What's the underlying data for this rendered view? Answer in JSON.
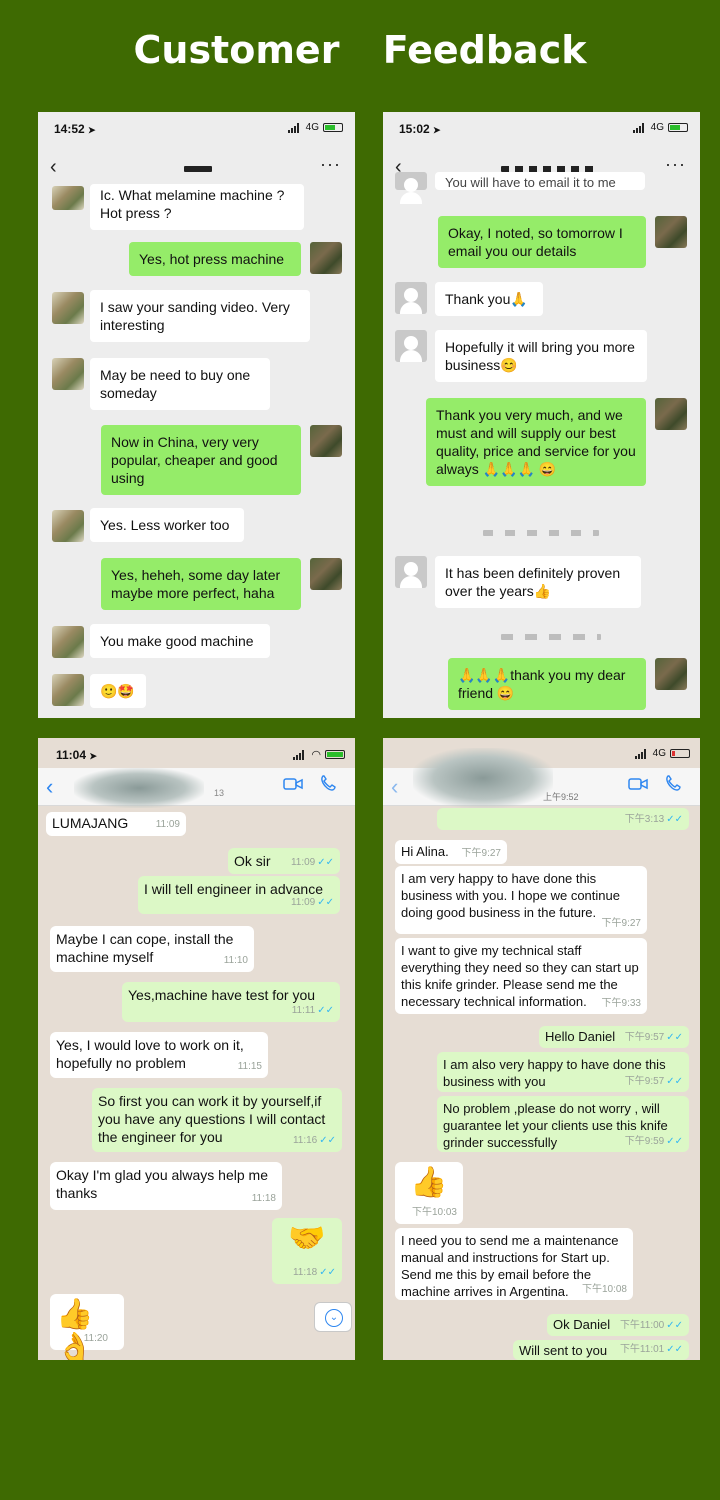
{
  "page_title_left": "Customer",
  "page_title_right": "Feedback",
  "panel1": {
    "time": "14:52",
    "network": "4G",
    "messages": {
      "m1": "Ic. What melamine machine ? Hot press ?",
      "m2": "Yes, hot press machine",
      "m3": "I saw your sanding video. Very interesting",
      "m4": "May be need to buy one someday",
      "m5": "Now in China, very very popular, cheaper and good using",
      "m6": "Yes. Less worker too",
      "m7": "Yes, heheh, some day later maybe more perfect, haha",
      "m8": "You make good machine",
      "m9": "🙂🤩"
    }
  },
  "panel2": {
    "time": "15:02",
    "network": "4G",
    "messages": {
      "m0": "You will have to email it to me",
      "m1": "Okay, I noted, so tomorrow I email you our details",
      "m2": "Thank you🙏",
      "m3": "Hopefully it will bring you more  business😊",
      "m4": "Thank you very much, and we must and will supply our best quality, price and service for you always 🙏🙏🙏 😄",
      "m5": "It has been definitely proven over the years👍",
      "m6": "🙏🙏🙏thank you my dear friend 😄"
    }
  },
  "panel3": {
    "time": "11:04",
    "header_fragment": "13",
    "messages": [
      {
        "text": "LUMAJANG",
        "time": "11:09"
      },
      {
        "text": "Ok sir",
        "time": "11:09"
      },
      {
        "text": "I will tell engineer in advance",
        "time": "11:09"
      },
      {
        "text": "Maybe I can cope, install the machine myself",
        "time": "11:10"
      },
      {
        "text": "Yes,machine have test for you",
        "time": "11:11"
      },
      {
        "text": "Yes, I would love to work on it, hopefully no problem",
        "time": "11:15"
      },
      {
        "text": "So first you can  work it by yourself,if you have any questions I will contact the engineer for you",
        "time": "11:16"
      },
      {
        "text": "Okay I'm glad you always help me thanks",
        "time": "11:18"
      },
      {
        "text": "🤝",
        "time": "11:18"
      },
      {
        "text": "👍👌",
        "time": "11:20"
      }
    ]
  },
  "panel4": {
    "network": "4G",
    "header_time": "上午9:52",
    "messages": [
      {
        "text": "",
        "time": "下午3:13"
      },
      {
        "text": "Hi Alina.",
        "time": "下午9:27"
      },
      {
        "text": "I am very happy to have done this business with you.  I hope we continue doing good business in the future.",
        "time": "下午9:27"
      },
      {
        "text": "I want to give my technical staff everything they need so they can start up this knife grinder. Please send me the necessary technical information.",
        "time": "下午9:33"
      },
      {
        "text": "Hello Daniel",
        "time": "下午9:57"
      },
      {
        "text": "I am also very happy to have done this business with you",
        "time": "下午9:57"
      },
      {
        "text": "No problem ,please do not worry , will guarantee let your clients use this knife grinder successfully",
        "time": "下午9:59"
      },
      {
        "text": "👍",
        "time": "下午10:03"
      },
      {
        "text": "I need you to send me a maintenance manual and instructions for Start up. Send me this by email before the machine arrives in Argentina.",
        "time": "下午10:08"
      },
      {
        "text": "Ok Daniel",
        "time": "下午11:00"
      },
      {
        "text": "Will sent to you",
        "time": "下午11:01"
      }
    ]
  },
  "icons": {
    "back": "chevron-left-icon",
    "more": "more-dots-icon",
    "video": "video-call-icon",
    "phone": "phone-call-icon"
  }
}
